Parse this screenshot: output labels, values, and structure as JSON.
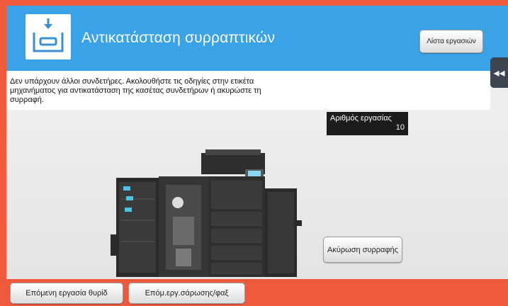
{
  "header": {
    "icon": "staple-cartridge-icon",
    "title": "Αντικατάσταση συρραπτικών",
    "job_list_label": "Λίστα εργασιών",
    "collapse_icon": "double-chevron-left-icon",
    "collapse_glyph": "◂◂",
    "accent_color": "#3aa3e8"
  },
  "message": {
    "text": "Δεν υπάρχουν άλλοι συνδετήρες. Ακολουθήστε τις οδηγίες στην ετικέτα μηχανήματος για αντικατάσταση της κασέτας συνδετήρων ή ακυρώστε τη συρραφή."
  },
  "job_number": {
    "label": "Αριθμός εργασίας",
    "value": "10"
  },
  "machine": {
    "icon": "multifunction-printer-icon"
  },
  "actions": {
    "cancel_stapling_label": "Ακύρωση συρραφής"
  },
  "footer": {
    "next_job_label": "Επόμενη εργασία θυρίδ",
    "scan_fax_label": "Επόμ.εργ.σάρωσης/φαξ",
    "bar_color": "#ef5a3c"
  }
}
